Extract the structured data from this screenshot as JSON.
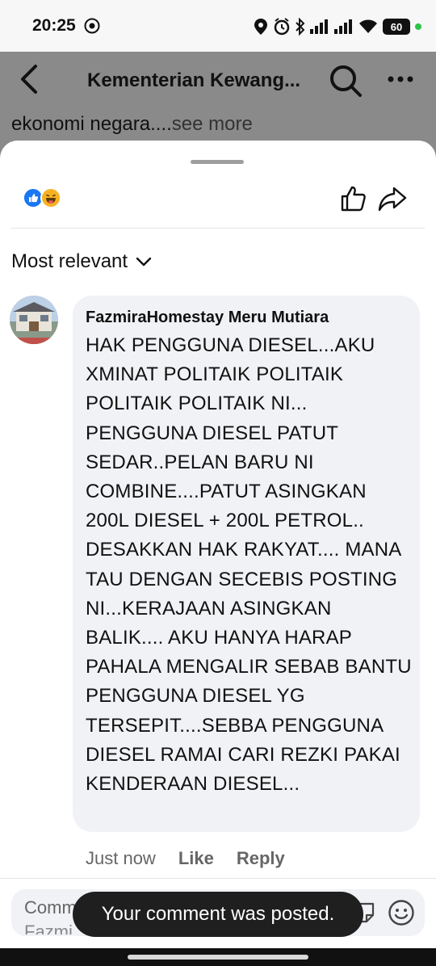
{
  "status_bar": {
    "time": "20:25",
    "battery": "60",
    "icons": [
      "gear-icon",
      "location-icon",
      "alarm-icon",
      "bluetooth-icon",
      "signal-icon",
      "signal-icon",
      "wifi-icon",
      "battery-icon"
    ]
  },
  "header": {
    "title": "Kementerian Kewang...",
    "post_snippet": "ekonomi negara....",
    "see_more": "see more"
  },
  "sort": {
    "label": "Most relevant"
  },
  "comment": {
    "author": "FazmiraHomestay Meru Mutiara",
    "text": "HAK PENGGUNA DIESEL...AKU XMINAT POLITAIK POLITAIK POLITAIK POLITAIK NI... PENGGUNA DIESEL PATUT SEDAR..PELAN BARU NI COMBINE....PATUT ASINGKAN 200L DIESEL + 200L PETROL.. DESAKKAN HAK RAKYAT.... MANA TAU DENGAN SECEBIS POSTING NI...KERAJAAN ASINGKAN BALIK.... AKU HANYA HARAP PAHALA MENGALIR SEBAB BANTU PENGGUNA DIESEL YG TERSEPIT....SEBBA PENGGUNA DIESEL RAMAI CARI REZKI PAKAI KENDERAAN DIESEL...",
    "time": "Just now",
    "like": "Like",
    "reply": "Reply"
  },
  "composer": {
    "placeholder": "Comm",
    "mention": "Fazmi"
  },
  "toast": {
    "text": "Your comment was posted."
  },
  "colors": {
    "like_blue": "#1877f2",
    "haha_yellow": "#f7b125",
    "toast_bg": "#1f1f1f"
  }
}
